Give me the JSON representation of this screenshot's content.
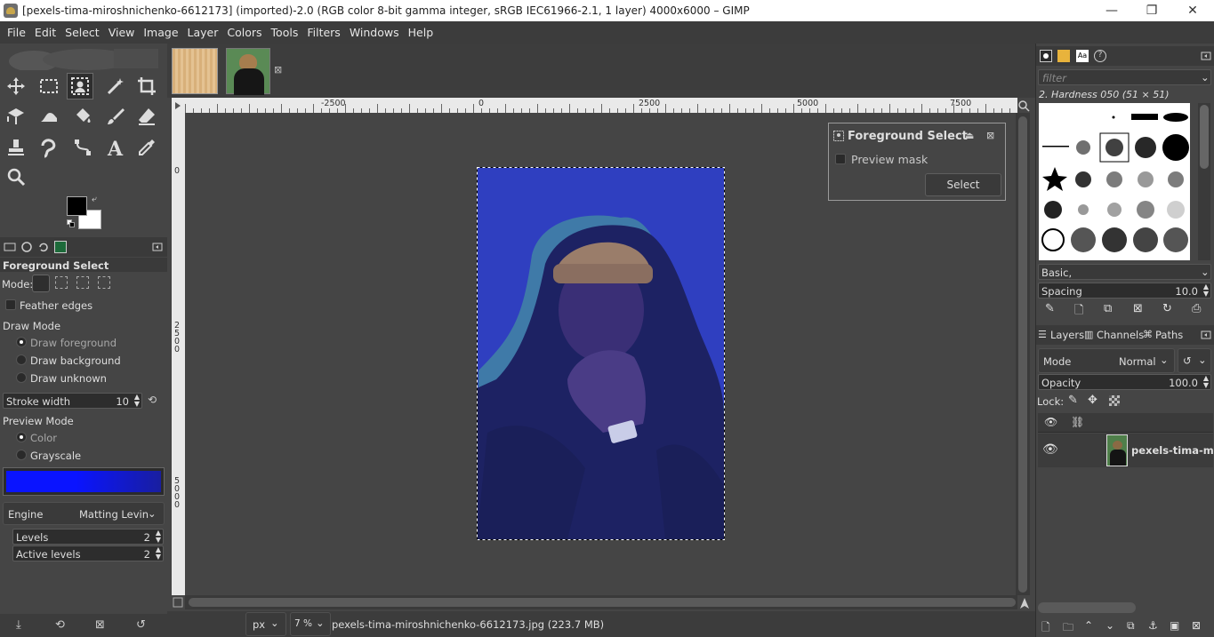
{
  "window": {
    "title": "[pexels-tima-miroshnichenko-6612173] (imported)-2.0 (RGB color 8-bit gamma integer, sRGB IEC61966-2.1, 1 layer) 4000x6000 – GIMP",
    "minimize": "—",
    "maximize": "❐",
    "close": "✕"
  },
  "menu": [
    "File",
    "Edit",
    "Select",
    "View",
    "Image",
    "Layer",
    "Colors",
    "Tools",
    "Filters",
    "Windows",
    "Help"
  ],
  "tool_options": {
    "title": "Foreground Select",
    "mode_label": "Mode:",
    "feather_edges": "Feather edges",
    "draw_mode_label": "Draw Mode",
    "draw_foreground": "Draw foreground",
    "draw_background": "Draw background",
    "draw_unknown": "Draw unknown",
    "stroke_width_label": "Stroke width",
    "stroke_width_value": "10",
    "preview_mode_label": "Preview Mode",
    "preview_color": "Color",
    "preview_grayscale": "Grayscale",
    "engine_label": "Engine",
    "engine_value": "Matting Levin",
    "levels_label": "Levels",
    "levels_value": "2",
    "active_levels_label": "Active levels",
    "active_levels_value": "2"
  },
  "rulers": {
    "top": [
      "-2500",
      "0",
      "2500",
      "5000",
      "7500"
    ],
    "left": [
      "0",
      "2500",
      "5000"
    ]
  },
  "status": {
    "unit": "px",
    "zoom": "7 %",
    "file": "pexels-tima-miroshnichenko-6612173.jpg (223.7 MB)"
  },
  "fg_dialog": {
    "title": "Foreground Select",
    "preview_mask": "Preview mask",
    "select_button": "Select"
  },
  "brushes": {
    "filter_placeholder": "filter",
    "selected": "2. Hardness 050 (51 × 51)",
    "preset": "Basic,",
    "spacing_label": "Spacing",
    "spacing_value": "10.0"
  },
  "layers_panel": {
    "tabs": [
      "Layers",
      "Channels",
      "Paths"
    ],
    "mode_label": "Mode",
    "mode_value": "Normal",
    "opacity_label": "Opacity",
    "opacity_value": "100.0",
    "lock_label": "Lock:",
    "layer_name": "pexels-tima-mir"
  },
  "colors": {
    "fg": "#000000",
    "bg": "#ffffff",
    "overlay_blue": "#2e3fbf",
    "preview_blue": "#0a14ff"
  }
}
